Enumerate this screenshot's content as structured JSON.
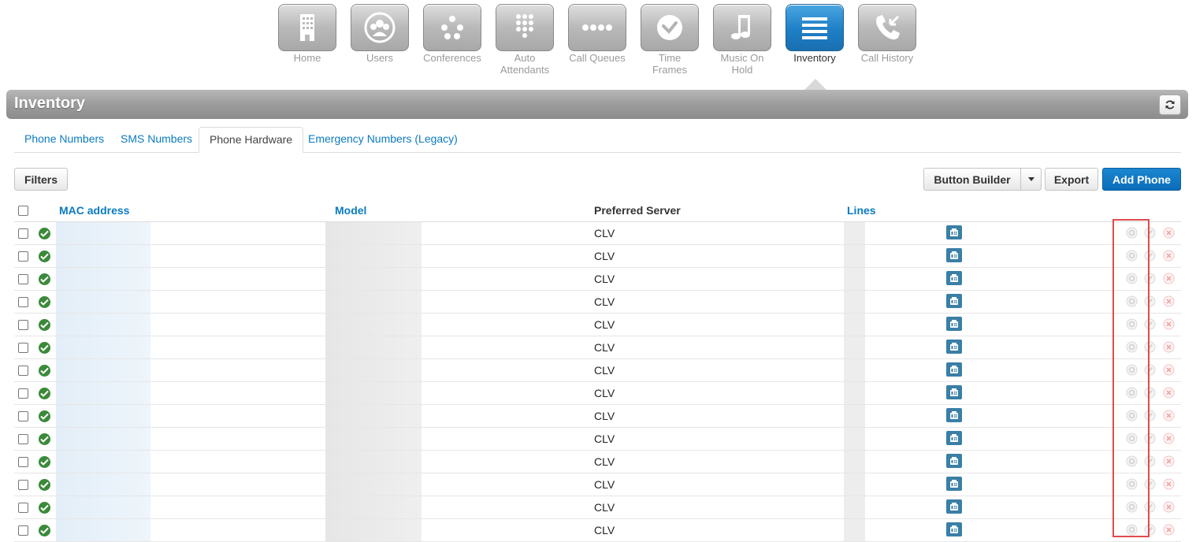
{
  "nav": {
    "items": [
      {
        "label": "Home",
        "icon": "building-icon"
      },
      {
        "label": "Users",
        "icon": "users-icon"
      },
      {
        "label": "Conferences",
        "icon": "conference-dots-icon"
      },
      {
        "label": "Auto Attendants",
        "icon": "keypad-icon"
      },
      {
        "label": "Call Queues",
        "icon": "queue-dots-icon"
      },
      {
        "label": "Time Frames",
        "icon": "clock-icon"
      },
      {
        "label": "Music On Hold",
        "icon": "music-note-icon"
      },
      {
        "label": "Inventory",
        "icon": "list-icon",
        "active": true
      },
      {
        "label": "Call History",
        "icon": "phone-history-icon"
      }
    ]
  },
  "page": {
    "title": "Inventory"
  },
  "tabs": [
    "Phone Numbers",
    "SMS Numbers",
    "Phone Hardware",
    "Emergency Numbers (Legacy)"
  ],
  "active_tab": "Phone Hardware",
  "toolbar": {
    "filters": "Filters",
    "button_builder": "Button Builder",
    "export": "Export",
    "add_phone": "Add Phone"
  },
  "table": {
    "columns": {
      "mac": "MAC address",
      "model": "Model",
      "server": "Preferred Server",
      "lines": "Lines"
    },
    "rows": [
      {
        "server": "CLV"
      },
      {
        "server": "CLV"
      },
      {
        "server": "CLV"
      },
      {
        "server": "CLV"
      },
      {
        "server": "CLV"
      },
      {
        "server": "CLV"
      },
      {
        "server": "CLV"
      },
      {
        "server": "CLV"
      },
      {
        "server": "CLV"
      },
      {
        "server": "CLV"
      },
      {
        "server": "CLV"
      },
      {
        "server": "CLV"
      },
      {
        "server": "CLV"
      },
      {
        "server": "CLV"
      }
    ]
  },
  "colors": {
    "accent": "#0b7bc0",
    "primary_button": "#0c6db9",
    "status_ok": "#3a8a3a",
    "line_button": "#3a7fa6",
    "highlight": "#e04c4c"
  }
}
